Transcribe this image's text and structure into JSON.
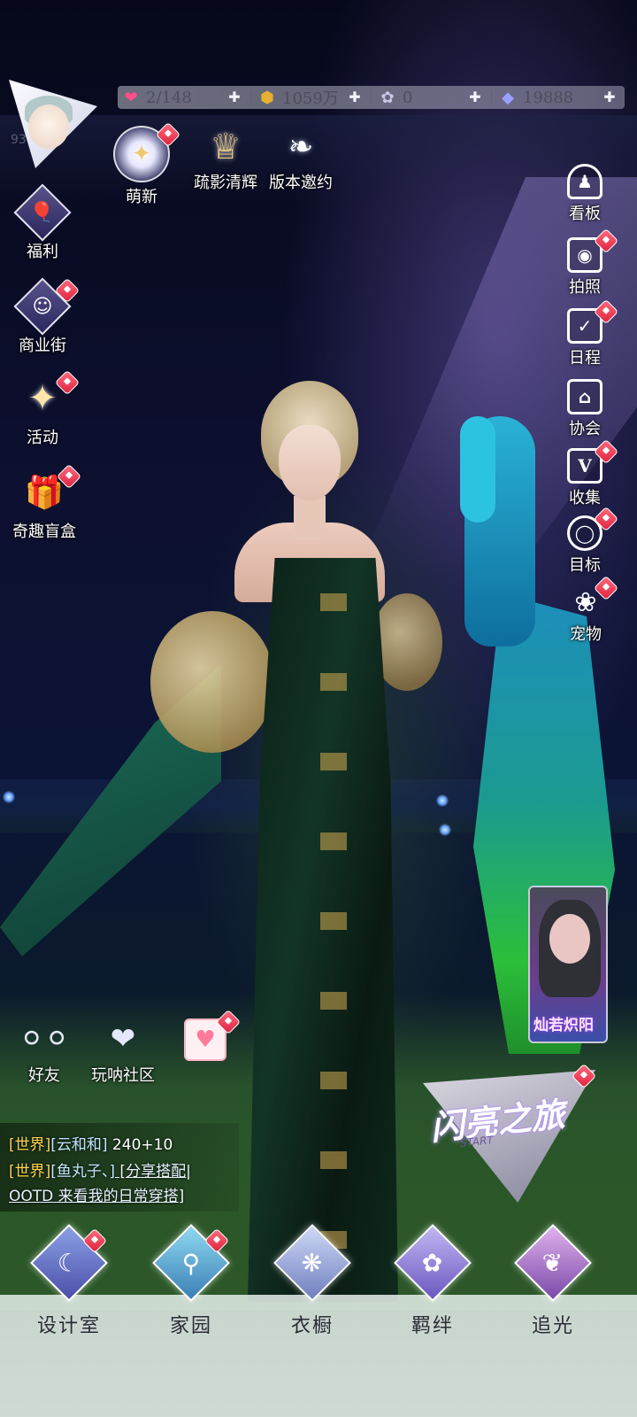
{
  "status_bar": {
    "stamina": "2/148",
    "gold": "1059万",
    "clover": "0",
    "diamond": "19888"
  },
  "avatar": {
    "level": "93"
  },
  "top_events": [
    {
      "label": "萌新",
      "icon": "sparkle-orb-icon"
    },
    {
      "label": "疏影清辉",
      "icon": "crown-icon"
    },
    {
      "label": "版本邀约",
      "icon": "swan-icon"
    }
  ],
  "left_menu": [
    {
      "label": "福利",
      "icon": "hot-air-balloon-icon"
    },
    {
      "label": "商业街",
      "icon": "shopping-bag-icon"
    },
    {
      "label": "活动",
      "icon": "stars-icon"
    },
    {
      "label": "奇趣盲盒",
      "icon": "gift-box-icon"
    }
  ],
  "right_menu": [
    {
      "label": "看板",
      "icon": "figure-icon"
    },
    {
      "label": "拍照",
      "icon": "camera-icon"
    },
    {
      "label": "日程",
      "icon": "calendar-check-icon"
    },
    {
      "label": "协会",
      "icon": "guild-hall-icon"
    },
    {
      "label": "收集",
      "icon": "v-collection-icon"
    },
    {
      "label": "目标",
      "icon": "target-medal-icon"
    },
    {
      "label": "宠物",
      "icon": "paw-icon"
    }
  ],
  "social": [
    {
      "label": "好友",
      "icon": "bubbles-icon"
    },
    {
      "label": "玩呐社区",
      "icon": "planet-heart-icon"
    },
    {
      "label": "",
      "icon": "gift-heart-icon"
    }
  ],
  "chat": {
    "line1": {
      "tag": "[世界]",
      "name": "[云和和]",
      "msg": " 240+10"
    },
    "line2": {
      "tag": "[世界]",
      "name": "[鱼丸子、]",
      "link": " [分享搭配|"
    },
    "line3": {
      "link": "OOTD 来看我的日常穿搭]"
    }
  },
  "start_card": {
    "title": "闪亮之旅",
    "subtitle": "START"
  },
  "event_card": {
    "label": "灿若炽阳"
  },
  "bottom_nav": [
    {
      "label": "设计室",
      "icon": "moon-pen-icon"
    },
    {
      "label": "家园",
      "icon": "key-icon"
    },
    {
      "label": "衣橱",
      "icon": "diamond-flower-icon"
    },
    {
      "label": "羁绊",
      "icon": "clover-icon"
    },
    {
      "label": "追光",
      "icon": "butterfly-icon"
    }
  ],
  "colors": {
    "badge": "#e0223e",
    "chat_tag": "#ffd34d",
    "chat_name": "#bfe6ff"
  }
}
